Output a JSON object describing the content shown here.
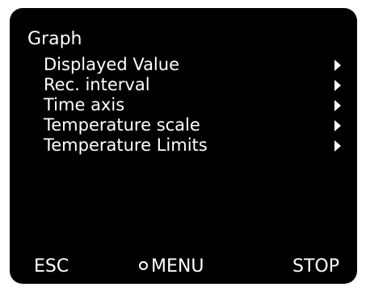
{
  "menu": {
    "title": "Graph",
    "items": [
      {
        "label": "Displayed Value",
        "icon": "submenu-arrow-icon"
      },
      {
        "label": "Rec. interval",
        "icon": "submenu-arrow-icon"
      },
      {
        "label": "Time axis",
        "icon": "submenu-arrow-icon"
      },
      {
        "label": "Temperature scale",
        "icon": "submenu-arrow-icon"
      },
      {
        "label": "Temperature Limits",
        "icon": "submenu-arrow-icon"
      }
    ]
  },
  "footer": {
    "esc_label": "ESC",
    "menu_label": "MENU",
    "menu_icon": "circle-icon",
    "stop_label": "STOP"
  },
  "colors": {
    "screen_background": "#000000",
    "text": "#ffffff"
  }
}
